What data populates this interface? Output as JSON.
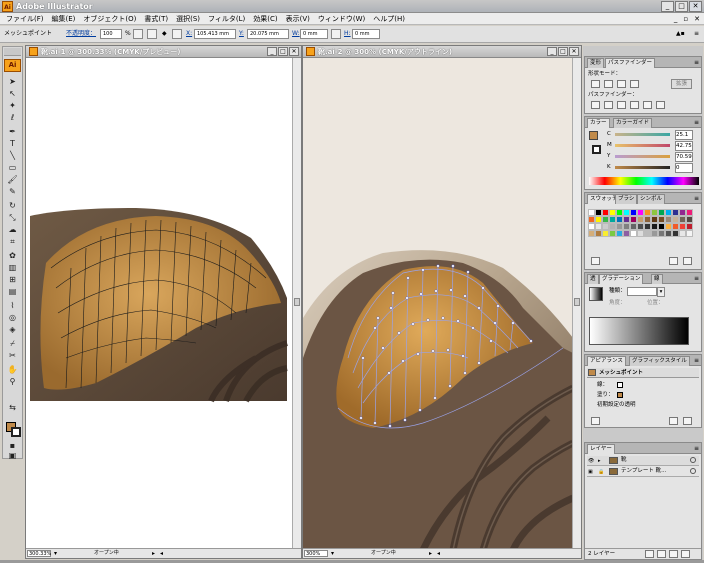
{
  "app": {
    "title": "Adobe Illustrator",
    "icon_label": "Ai",
    "window_buttons": [
      "_",
      "□",
      "✕"
    ]
  },
  "menu": {
    "items": [
      "ファイル(F)",
      "編集(E)",
      "オブジェクト(O)",
      "書式(T)",
      "選択(S)",
      "フィルタ(L)",
      "効果(C)",
      "表示(V)",
      "ウィンドウ(W)",
      "ヘルプ(H)"
    ]
  },
  "control_bar": {
    "selection_label": "メッシュポイント",
    "opacity_label": "不透明度：",
    "opacity_value": "100",
    "opacity_unit": "%",
    "x_label": "X:",
    "x_value": "105.413 mm",
    "y_label": "Y:",
    "y_value": "20.075 mm",
    "w_label": "W:",
    "w_value": "0 mm",
    "h_label": "H:",
    "h_value": "0 mm"
  },
  "tools": {
    "logo": "Ai",
    "icons": [
      "selection-tool-icon",
      "direct-selection-tool-icon",
      "magic-wand-icon",
      "lasso-icon",
      "pen-tool-icon",
      "type-tool-icon",
      "line-tool-icon",
      "rectangle-tool-icon",
      "paintbrush-icon",
      "pencil-icon",
      "rotate-tool-icon",
      "scale-tool-icon",
      "warp-tool-icon",
      "free-transform-icon",
      "symbol-sprayer-icon",
      "graph-tool-icon",
      "mesh-tool-icon",
      "gradient-tool-icon",
      "eyedropper-icon",
      "blend-tool-icon",
      "live-paint-icon",
      "slice-tool-icon",
      "scissors-icon",
      "hand-tool-icon",
      "zoom-tool-icon"
    ]
  },
  "doc_left": {
    "title": "靴.ai-1 @ 300.33% (CMYK/プレビュー)",
    "zoom": "300.33%",
    "status": "オープン中"
  },
  "doc_right": {
    "title": "靴.ai-2 @ 300% (CMYK/アウトライン)",
    "zoom": "300%",
    "status": "オープン中"
  },
  "panels": {
    "pathfinder": {
      "tabs": [
        "変形",
        "パスファインダー"
      ],
      "shape_mode_label": "形状モード：",
      "expand_label": "拡張",
      "pathfinder_label": "パスファインダー："
    },
    "color": {
      "tabs": [
        "カラー",
        "カラーガイド"
      ],
      "channels": [
        {
          "label": "C",
          "value": "25.1",
          "unit": "%"
        },
        {
          "label": "M",
          "value": "42.75",
          "unit": "%"
        },
        {
          "label": "Y",
          "value": "70.59",
          "unit": "%"
        },
        {
          "label": "K",
          "value": "0",
          "unit": "%"
        }
      ],
      "current_color": "#c08a4a"
    },
    "swatches": {
      "tabs": [
        "スウォッチ",
        "ブラシ",
        "シンボル"
      ],
      "colors": [
        "#ffffff",
        "#000000",
        "#ff0000",
        "#ffff00",
        "#00ff00",
        "#00ffff",
        "#0000ff",
        "#ff00ff",
        "#f7941d",
        "#8dc63f",
        "#00a651",
        "#00aeef",
        "#2e3192",
        "#92278f",
        "#ed1c79",
        "#f26522",
        "#fff200",
        "#39b54a",
        "#00a99d",
        "#0072bc",
        "#662d91",
        "#9e005d",
        "#c69c6d",
        "#8c6239",
        "#603913",
        "#754c24",
        "#998675",
        "#c7b299",
        "#736357",
        "#534741",
        "#ffffff",
        "#e6e6e6",
        "#cccccc",
        "#b3b3b3",
        "#999999",
        "#808080",
        "#666666",
        "#4d4d4d",
        "#333333",
        "#1a1a1a",
        "#000000",
        "#fbb040",
        "#f15a29",
        "#ef4136",
        "#be1e2d",
        "#d4ae7a",
        "#b07c3f",
        "#f9ed32",
        "#7ac943",
        "#29abe2",
        "#8e5ea2",
        "#ffffff",
        "#dddddd",
        "#bbbbbb",
        "#999999",
        "#777777",
        "#555555",
        "#333333",
        "#e7e7e7",
        "#f4f4f4"
      ]
    },
    "gradient": {
      "tabs": [
        "グラデーション",
        "線"
      ],
      "type_label": "種類：",
      "angle_label": "角度：",
      "location_label": "位置："
    },
    "appearance": {
      "tabs": [
        "アピアランス",
        "グラフィックスタイル"
      ],
      "header": "メッシュポイント",
      "rows": [
        "線：",
        "塗り：",
        "初期設定の透明"
      ]
    },
    "layers": {
      "tabs": [
        "レイヤー"
      ],
      "rows": [
        {
          "name": "靴"
        },
        {
          "name": "テンプレート 靴..."
        }
      ],
      "footer": "2 レイヤー"
    }
  }
}
